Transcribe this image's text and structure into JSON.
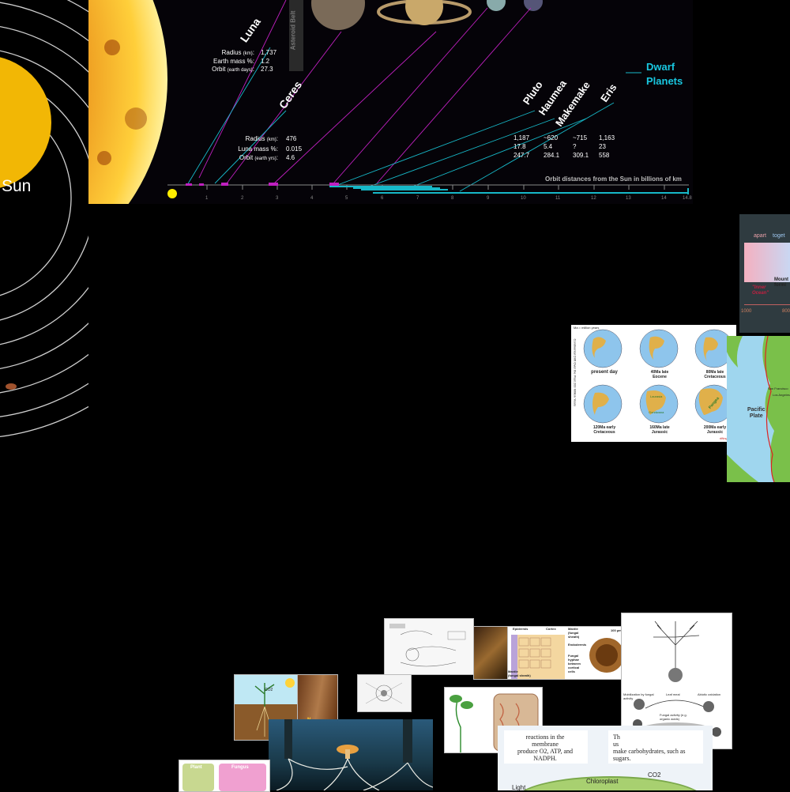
{
  "left_panel": {
    "sun_label": "Sun"
  },
  "solar_diagram": {
    "luna": {
      "name": "Luna",
      "radius_label": "Radius",
      "radius_unit": "(km)",
      "radius_value": "1,737",
      "mass_label": "Earth mass %:",
      "mass_value": "1.2",
      "orbit_label": "Orbit",
      "orbit_unit": "(earth days)",
      "orbit_value": "27.3"
    },
    "asteroid_belt": "Asteroid Belt",
    "ceres": {
      "name": "Ceres",
      "radius_label": "Radius",
      "radius_unit": "(km)",
      "radius_value": "476",
      "mass_label": "Luna mass %:",
      "mass_value": "0.015",
      "orbit_label": "Orbit",
      "orbit_unit": "(earth yrs)",
      "orbit_value": "4.6"
    },
    "dwarf_title_line1": "Dwarf",
    "dwarf_title_line2": "Planets",
    "dwarfs": [
      {
        "name": "Pluto",
        "radius": "1,187",
        "mass": "17.8",
        "orbit": "247.7"
      },
      {
        "name": "Haumea",
        "radius": "~620",
        "mass": "5.4",
        "orbit": "284.1"
      },
      {
        "name": "Makemake",
        "radius": "~715",
        "mass": "?",
        "orbit": "309.1"
      },
      {
        "name": "Eris",
        "radius": "1,163",
        "mass": "23",
        "orbit": "558"
      }
    ],
    "axis_caption": "Orbit distances from the Sun in billions of km",
    "axis_ticks": [
      "1",
      "2",
      "3",
      "4",
      "5",
      "6",
      "7",
      "8",
      "9",
      "10",
      "11",
      "12",
      "13",
      "14",
      "14.8"
    ]
  },
  "plate_timeline": {
    "apart_label": "apart",
    "together_label": "toget",
    "inner_ocean_label": "\"Inner\nOcean\"",
    "mountain_label": "Mount\nformi",
    "axis_values": [
      "1000",
      "800"
    ]
  },
  "globes_grid": {
    "header": "Ma = million years",
    "side_caption": "Continental Drift Over the Past 200 Million Years",
    "cells": [
      {
        "label": "present day"
      },
      {
        "label": "40Ma late\nEocene"
      },
      {
        "label": "80Ma late\nCretaceous"
      },
      {
        "label": "120Ma early\nCretaceous"
      },
      {
        "label": "160Ma late\nJurassic"
      },
      {
        "label": "200Ma early\nJurassic"
      }
    ],
    "legend": "rifting",
    "annotations": [
      "Gondwana",
      "Laurasia",
      "Pangea"
    ]
  },
  "plate_map": {
    "city1": "San Francisco",
    "city2": "Los Angeles",
    "plate_label": "Pacific\nPlate"
  },
  "mycorrhiza_tiles": {
    "root_section_labels": [
      "Epidermis",
      "Cortex",
      "Mantle\n(fungal\nsheath)",
      "Endodermis",
      "Fungal\nhyphae\nbetween\ncortical\ncells",
      "Mantle\n(fungal sheath)"
    ],
    "scale": "100 µm",
    "nutrient_labels": [
      "Mobilization by fungal activity",
      "Leaf meal",
      "Abiotic oxidation",
      "Fungal activity (e.g. organic acids)"
    ],
    "photo_text": "reactions in the\nmembrane\nproduce O2, ATP, and\nNADPH.",
    "photo_text2": "Th\nus\nmake carbohydrates, such as\nsugars.",
    "chloroplast": "Chloroplast",
    "co2": "CO2",
    "light": "Light",
    "plant_label": "Plant",
    "fungus_label": "Fungus",
    "co2_small": "CO2",
    "n_label": "N"
  }
}
